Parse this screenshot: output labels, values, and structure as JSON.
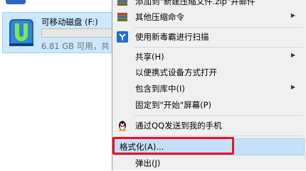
{
  "explorer": {
    "drive_name": "可移动磁盘 (F:)",
    "drive_free": "6.81 GB 可用，共",
    "drive_used_fraction": 0.02
  },
  "menu": {
    "items": [
      {
        "label": "添加到\"新建压缩文件.zip\"并邮件",
        "icon": "archive-icon"
      },
      {
        "label": "其他压缩命令",
        "icon": "archive-icon",
        "submenu": true
      },
      {
        "label": "使用新毒霸进行扫描",
        "icon": "shield-icon"
      },
      {
        "label": "共享(H)",
        "submenu": true
      },
      {
        "label": "以便携式设备方式打开"
      },
      {
        "label": "包含到库中(I)",
        "submenu": true
      },
      {
        "label": "固定到\"开始\"屏幕(P)"
      },
      {
        "label": "通过QQ发送到我的手机",
        "icon": "qq-penguin-icon"
      },
      {
        "label": "格式化(A)..."
      },
      {
        "label": "弹出(J)"
      }
    ]
  },
  "colors": {
    "selection": "#cce8ff",
    "menu_bg": "#f0f0f0",
    "highlight_border": "#e81123"
  }
}
